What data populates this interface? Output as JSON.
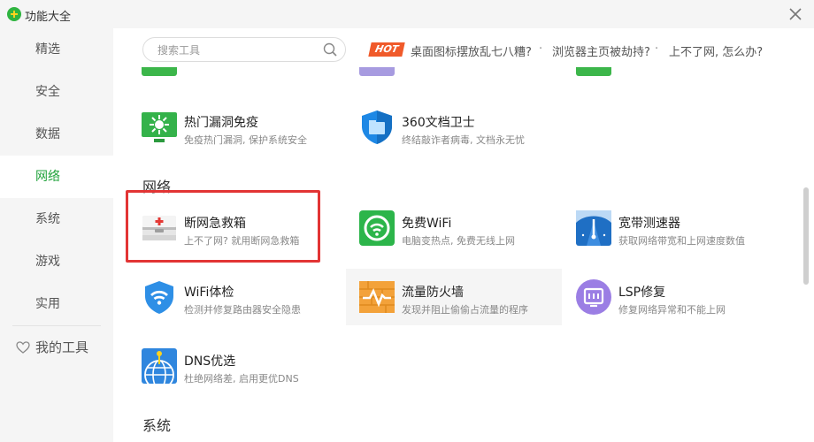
{
  "window": {
    "title": "功能大全"
  },
  "sidebar": {
    "items": [
      {
        "label": "精选",
        "active": false
      },
      {
        "label": "安全",
        "active": false
      },
      {
        "label": "数据",
        "active": false
      },
      {
        "label": "网络",
        "active": true
      },
      {
        "label": "系统",
        "active": false
      },
      {
        "label": "游戏",
        "active": false
      },
      {
        "label": "实用",
        "active": false
      }
    ],
    "my_tools": "我的工具"
  },
  "search": {
    "placeholder": "搜索工具"
  },
  "hot": {
    "badge": "HOT",
    "links": [
      "桌面图标摆放乱七八糟?",
      "浏览器主页被劫持?",
      "上不了网, 怎么办?"
    ],
    "separator": "·"
  },
  "tools_top": [
    {
      "name": "热门漏洞免疫",
      "desc": "免疫热门漏洞, 保护系统安全",
      "icon": "vulnerability-shield-icon"
    },
    {
      "name": "360文档卫士",
      "desc": "终结敲诈者病毒, 文档永无忧",
      "icon": "document-guard-icon"
    }
  ],
  "sections": {
    "network": "网络",
    "system": "系统"
  },
  "network_tools": [
    {
      "name": "断网急救箱",
      "desc": "上不了网? 就用断网急救箱",
      "icon": "first-aid-kit-icon"
    },
    {
      "name": "免费WiFi",
      "desc": "电脑变热点, 免费无线上网",
      "icon": "free-wifi-icon"
    },
    {
      "name": "宽带测速器",
      "desc": "获取网络带宽和上网速度数值",
      "icon": "speed-meter-icon"
    },
    {
      "name": "WiFi体检",
      "desc": "检测并修复路由器安全隐患",
      "icon": "wifi-shield-icon"
    },
    {
      "name": "流量防火墙",
      "desc": "发现并阻止偷偷占流量的程序",
      "icon": "firewall-icon"
    },
    {
      "name": "LSP修复",
      "desc": "修复网络异常和不能上网",
      "icon": "lsp-repair-icon"
    },
    {
      "name": "DNS优选",
      "desc": "杜绝网络差, 启用更优DNS",
      "icon": "dns-globe-icon"
    }
  ],
  "colors": {
    "accent": "#22a33c",
    "hot": "#f05a2a",
    "highlight": "#e23434"
  }
}
